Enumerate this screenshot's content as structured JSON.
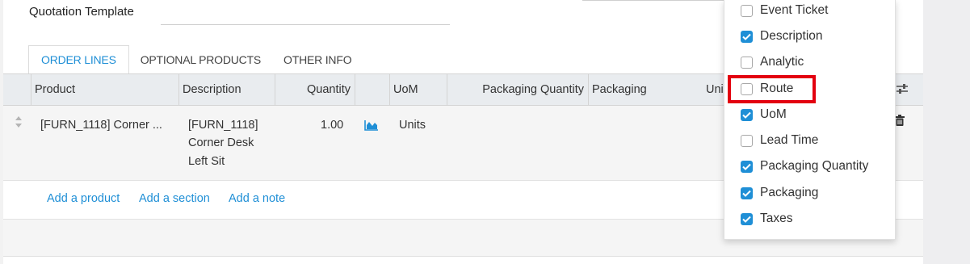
{
  "form": {
    "quotation_template_label": "Quotation Template"
  },
  "tabs": [
    {
      "label": "ORDER LINES",
      "active": true
    },
    {
      "label": "OPTIONAL PRODUCTS",
      "active": false
    },
    {
      "label": "OTHER INFO",
      "active": false
    }
  ],
  "table": {
    "columns": {
      "product": "Product",
      "description": "Description",
      "quantity": "Quantity",
      "uom": "UoM",
      "packaging_quantity": "Packaging Quantity",
      "packaging": "Packaging",
      "unit_price_truncated": "Uni"
    },
    "row": {
      "product": "[FURN_1118] Corner ...",
      "description_line1": "[FURN_1118]",
      "description_line2": "Corner Desk",
      "description_line3": "Left Sit",
      "quantity": "1.00",
      "uom": "Units"
    },
    "add_links": {
      "product": "Add a product",
      "section": "Add a section",
      "note": "Add a note"
    }
  },
  "column_dropdown": {
    "items": [
      {
        "label": "Event Ticket",
        "checked": false
      },
      {
        "label": "Description",
        "checked": true
      },
      {
        "label": "Analytic",
        "checked": false
      },
      {
        "label": "Route",
        "checked": false,
        "highlighted": true
      },
      {
        "label": "UoM",
        "checked": true
      },
      {
        "label": "Lead Time",
        "checked": false
      },
      {
        "label": "Packaging Quantity",
        "checked": true
      },
      {
        "label": "Packaging",
        "checked": true
      },
      {
        "label": "Taxes",
        "checked": true
      }
    ]
  },
  "colors": {
    "accent": "#1f8fd6",
    "highlight": "#e3000f"
  },
  "icons": {
    "settings": "optional-columns-icon",
    "handle": "drag-handle-icon",
    "forecast": "forecast-chart-icon",
    "delete": "trash-icon",
    "check": "checkmark-icon"
  }
}
